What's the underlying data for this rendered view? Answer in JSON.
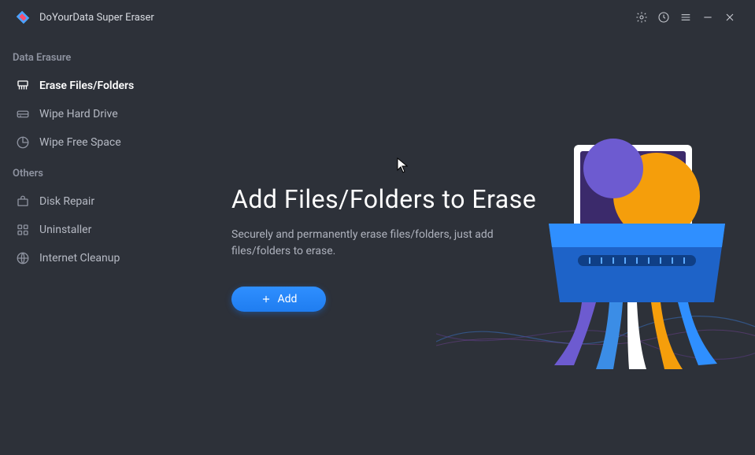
{
  "app": {
    "title": "DoYourData Super Eraser"
  },
  "sidebar": {
    "section_data_erasure": "Data Erasure",
    "section_others": "Others",
    "items": {
      "erase_files": "Erase Files/Folders",
      "wipe_hard_drive": "Wipe Hard Drive",
      "wipe_free_space": "Wipe Free Space",
      "disk_repair": "Disk Repair",
      "uninstaller": "Uninstaller",
      "internet_cleanup": "Internet Cleanup"
    }
  },
  "main": {
    "heading": "Add Files/Folders to Erase",
    "subtext": "Securely and permanently erase files/folders, just add files/folders to erase.",
    "add_label": "Add"
  },
  "icons": {
    "settings": "gear-icon",
    "history": "clock-icon",
    "menu": "menu-icon",
    "minimize": "minimize-icon",
    "close": "close-icon"
  },
  "colors": {
    "accent": "#1f7df0",
    "bg": "#2d3139",
    "text": "#c8cbd2"
  }
}
